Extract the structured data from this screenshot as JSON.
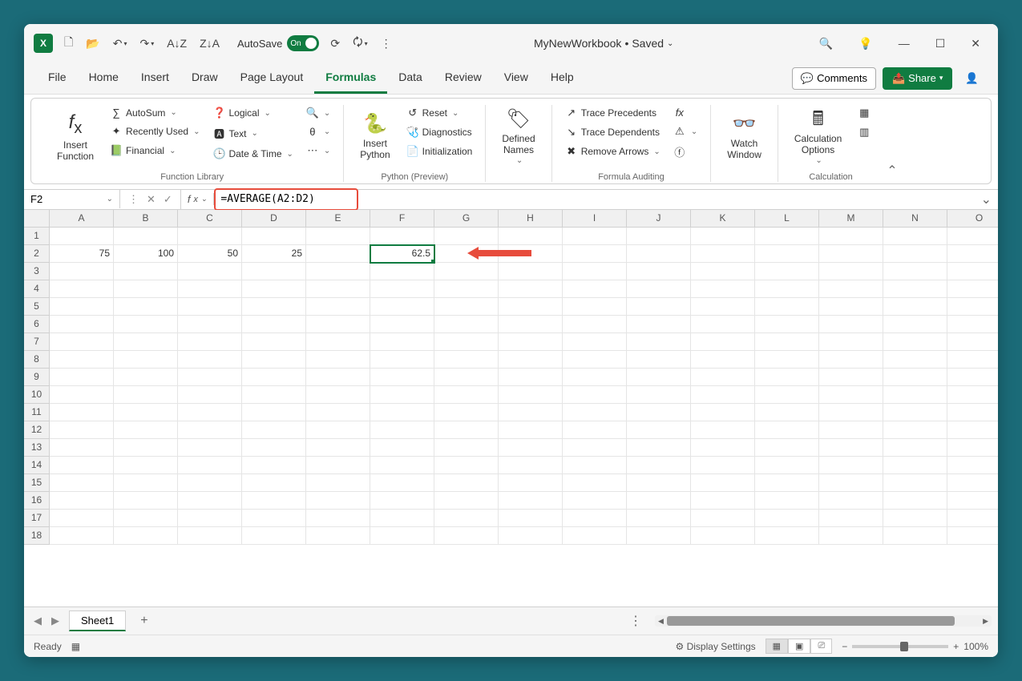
{
  "titlebar": {
    "autosave_label": "AutoSave",
    "autosave_state": "On",
    "doc_name": "MyNewWorkbook",
    "doc_status": "Saved"
  },
  "tabs": [
    "File",
    "Home",
    "Insert",
    "Draw",
    "Page Layout",
    "Formulas",
    "Data",
    "Review",
    "View",
    "Help"
  ],
  "active_tab": "Formulas",
  "actions": {
    "comments": "Comments",
    "share": "Share"
  },
  "ribbon": {
    "fnlib": {
      "label": "Function Library",
      "insert_fn": "Insert\nFunction",
      "autosum": "AutoSum",
      "recent": "Recently Used",
      "financial": "Financial",
      "logical": "Logical",
      "text": "Text",
      "datetime": "Date & Time"
    },
    "python": {
      "label": "Python (Preview)",
      "insert_py": "Insert\nPython",
      "reset": "Reset",
      "diag": "Diagnostics",
      "init": "Initialization"
    },
    "defnames": {
      "label": "",
      "defined": "Defined\nNames"
    },
    "audit": {
      "label": "Formula Auditing",
      "precedents": "Trace Precedents",
      "dependents": "Trace Dependents",
      "remove": "Remove Arrows"
    },
    "watch": {
      "btn": "Watch\nWindow"
    },
    "calc": {
      "label": "Calculation",
      "options": "Calculation\nOptions"
    }
  },
  "formula_bar": {
    "namebox": "F2",
    "formula": "=AVERAGE(A2:D2)"
  },
  "grid": {
    "columns": [
      "A",
      "B",
      "C",
      "D",
      "E",
      "F",
      "G",
      "H",
      "I",
      "J",
      "K",
      "L",
      "M",
      "N",
      "O"
    ],
    "rows": 18,
    "cells": {
      "A2": "75",
      "B2": "100",
      "C2": "50",
      "D2": "25",
      "F2": "62.5"
    },
    "selected": "F2"
  },
  "sheet_tabs": {
    "active": "Sheet1"
  },
  "status": {
    "ready": "Ready",
    "display": "Display Settings",
    "zoom": "100%"
  }
}
